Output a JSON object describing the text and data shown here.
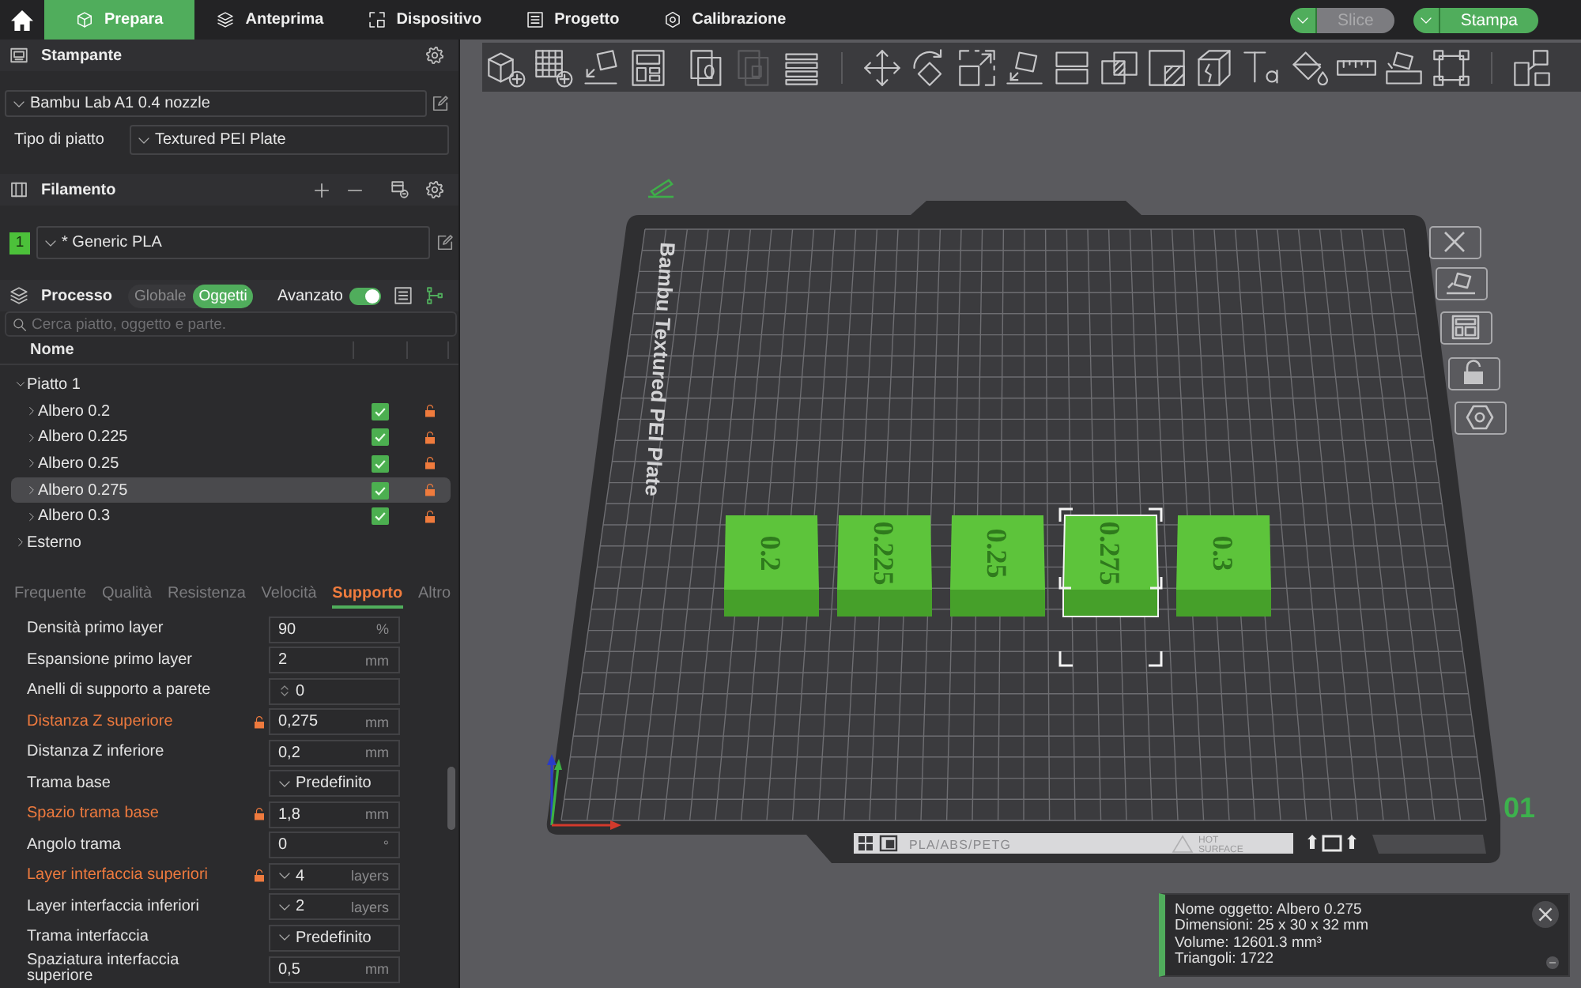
{
  "top_bar": {
    "tabs": [
      {
        "label": "Prepara",
        "selected": true
      },
      {
        "label": "Anteprima",
        "selected": false
      },
      {
        "label": "Dispositivo",
        "selected": false
      },
      {
        "label": "Progetto",
        "selected": false
      },
      {
        "label": "Calibrazione",
        "selected": false
      }
    ],
    "actions": [
      {
        "label": "Slice",
        "disabled": true
      },
      {
        "label": "Stampa",
        "disabled": false
      }
    ]
  },
  "sidebar": {
    "printer": {
      "title": "Stampante",
      "preset": "Bambu Lab A1 0.4 nozzle",
      "plate_type_label": "Tipo di piatto",
      "plate_type": "Textured PEI Plate"
    },
    "filament": {
      "title": "Filamento",
      "items": [
        {
          "number": "1",
          "name": "* Generic PLA",
          "color": "#4cc13a"
        }
      ]
    },
    "process": {
      "title": "Processo",
      "modes": [
        {
          "label": "Globale",
          "selected": false
        },
        {
          "label": "Oggetti",
          "selected": true
        }
      ],
      "advanced_label": "Avanzato",
      "advanced": true
    },
    "search": {
      "placeholder": "Cerca piatto, oggetto e parte."
    },
    "object_list": {
      "columns": [
        "Nome"
      ],
      "items": [
        {
          "label": "Piatto 1",
          "expanded": true,
          "selected": false,
          "children": [
            {
              "label": "Albero 0.2",
              "expanded": false,
              "selected": false,
              "checked": true
            },
            {
              "label": "Albero 0.225",
              "expanded": false,
              "selected": false,
              "checked": true
            },
            {
              "label": "Albero 0.25",
              "expanded": false,
              "selected": false,
              "checked": true
            },
            {
              "label": "Albero 0.275",
              "expanded": false,
              "selected": true,
              "checked": true
            },
            {
              "label": "Albero 0.3",
              "expanded": false,
              "selected": false,
              "checked": true
            }
          ]
        },
        {
          "label": "Esterno",
          "expanded": false,
          "selected": false
        }
      ]
    },
    "settings_tabs": [
      {
        "label": "Frequente",
        "selected": false
      },
      {
        "label": "Qualità",
        "selected": false
      },
      {
        "label": "Resistenza",
        "selected": false
      },
      {
        "label": "Velocità",
        "selected": false
      },
      {
        "label": "Supporto",
        "selected": true
      },
      {
        "label": "Altro",
        "selected": false
      }
    ],
    "settings": [
      {
        "label": "Densità primo layer",
        "kind": "input",
        "value": "90",
        "unit": "%",
        "modified": false
      },
      {
        "label": "Espansione primo layer",
        "kind": "input",
        "value": "2",
        "unit": "mm",
        "modified": false
      },
      {
        "label": "Anelli di supporto a parete",
        "kind": "spin",
        "value": "0",
        "modified": false
      },
      {
        "label": "Distanza Z superiore",
        "kind": "input",
        "value": "0,275",
        "unit": "mm",
        "modified": true
      },
      {
        "label": "Distanza Z inferiore",
        "kind": "input",
        "value": "0,2",
        "unit": "mm",
        "modified": false
      },
      {
        "label": "Trama base",
        "kind": "dropdown",
        "value": "Predefinito",
        "modified": false
      },
      {
        "label": "Spazio trama base",
        "kind": "input",
        "value": "1,8",
        "unit": "mm",
        "modified": true
      },
      {
        "label": "Angolo trama",
        "kind": "input",
        "value": "0",
        "unit": "°",
        "modified": false
      },
      {
        "label": "Layer interfaccia superiori",
        "kind": "dropdown",
        "value": "4",
        "unit": "layers",
        "modified": true
      },
      {
        "label": "Layer interfaccia inferiori",
        "kind": "dropdown",
        "value": "2",
        "unit": "layers",
        "modified": false
      },
      {
        "label": "Trama interfaccia",
        "kind": "dropdown",
        "value": "Predefinito",
        "modified": false
      },
      {
        "label": "Spaziatura interfaccia superiore",
        "kind": "input",
        "value": "0,5",
        "unit": "mm",
        "modified": false
      }
    ]
  },
  "viewport": {
    "plate": {
      "label": "Bambu Textured PEI Plate",
      "number": "01",
      "material_text": "PLA/ABS/PETG",
      "warning_lines": [
        "HOT",
        "SURFACE"
      ]
    },
    "objects": [
      {
        "label": "0.2",
        "selected": false
      },
      {
        "label": "0.225",
        "selected": false
      },
      {
        "label": "0.25",
        "selected": false
      },
      {
        "label": "0.275",
        "selected": true
      },
      {
        "label": "0.3",
        "selected": false
      }
    ],
    "object_info": {
      "lines": [
        "Nome oggetto: Albero 0.275",
        "Dimensioni: 25 x 30 x 32 mm",
        "Volume: 12601.3 mm³",
        "Triangoli: 1722"
      ]
    }
  }
}
